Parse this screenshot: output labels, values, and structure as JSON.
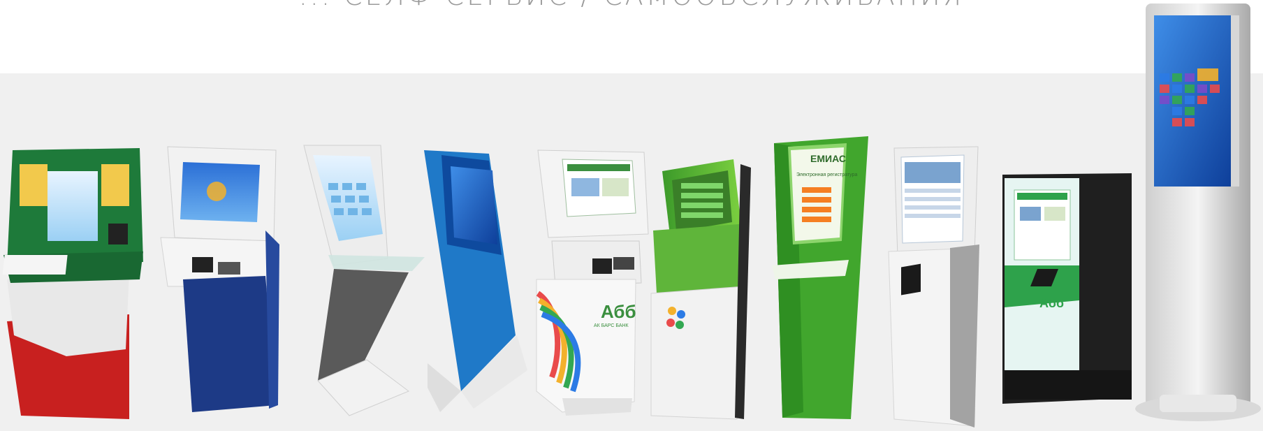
{
  "page": {
    "heading": "... СЕЛФ-СЕРВИС / САМООБСЛУЖИВАНИЯ"
  },
  "kiosks": [
    {
      "id": "kiosk-green-red",
      "brand_colors": [
        "#1e7a3a",
        "#c8201f",
        "#e9e9e9"
      ]
    },
    {
      "id": "kiosk-white-navy",
      "brand_colors": [
        "#f2f2f2",
        "#1d3a86"
      ]
    },
    {
      "id": "kiosk-white-angled",
      "brand_colors": [
        "#ededed",
        "#555555"
      ]
    },
    {
      "id": "kiosk-blue-slim",
      "brand_colors": [
        "#1f79c8",
        "#0e4a9e"
      ]
    },
    {
      "id": "kiosk-white-bank",
      "brand_colors": [
        "#f4f4f4",
        "#3b8f3f"
      ],
      "logo_text": "Абб",
      "bank_text": "АК БАРС БАНК"
    },
    {
      "id": "kiosk-green-curved",
      "brand_colors": [
        "#5fb53a",
        "#2a2a2a"
      ]
    },
    {
      "id": "kiosk-green-emias",
      "brand_colors": [
        "#41a62d",
        "#ffffff"
      ],
      "screen_title": "ЕМИАС",
      "screen_subtitle": "Электронная регистратура"
    },
    {
      "id": "kiosk-white-silver",
      "brand_colors": [
        "#eeeeee",
        "#8c8c8c"
      ]
    },
    {
      "id": "kiosk-black-green",
      "brand_colors": [
        "#1f1f1f",
        "#2ea24b"
      ],
      "logo_text": "Абб"
    },
    {
      "id": "kiosk-tall-tower",
      "brand_colors": [
        "#e6e6e6",
        "#1a3f8c"
      ]
    }
  ]
}
